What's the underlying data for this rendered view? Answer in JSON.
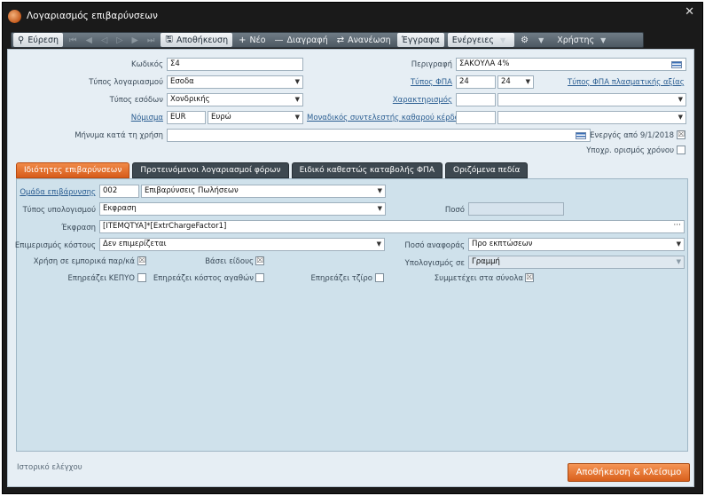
{
  "window": {
    "title": "Λογαριασμός επιβαρύνσεων"
  },
  "toolbar": {
    "search": "Εύρεση",
    "save": "Αποθήκευση",
    "new": "Νέο",
    "delete": "Διαγραφή",
    "refresh": "Ανανέωση",
    "form": "Έγγραφα",
    "actions": "Ενέργειες",
    "user": "Χρήστης"
  },
  "form": {
    "code_label": "Κωδικός",
    "code_value": "Σ4",
    "description_label": "Περιγραφή",
    "description_value": "ΣΑΚΟΥΛΑ 4%",
    "account_type_label": "Τύπος λογαριασμού",
    "account_type_value": "Εσοδα",
    "vat_type_label": "Τύπος ΦΠΑ",
    "vat_type_value1": "24",
    "vat_type_value2": "24",
    "vat_type_link": "Τύπος ΦΠΑ πλασματικής αξίας",
    "revenue_type_label": "Τύπος εσόδων",
    "revenue_type_value": "Χονδρικής",
    "characterization_label": "Χαρακτηρισμός",
    "currency_label": "Νόμισμα",
    "currency_code": "EUR",
    "currency_name": "Ευρώ",
    "net_profit_label": "Μοναδικός συντελεστής καθαρού κέρδους",
    "message_label": "Μήνυμα κατά τη χρήση",
    "active_from_label": "Ενεργός από 9/1/2018",
    "active_check": "☒",
    "time_def_label": "Υποχρ. ορισμός χρόνου"
  },
  "tabs": [
    "Ιδιότητες επιβαρύνσεων",
    "Προτεινόμενοι λογαριασμοί φόρων",
    "Ειδικό καθεστώς καταβολής ΦΠΑ",
    "Οριζόμενα πεδία"
  ],
  "panel": {
    "group_label": "Ομάδα επιβάρυνσης",
    "group_code": "002",
    "group_name": "Επιβαρύνσεις Πωλήσεων",
    "calc_type_label": "Τύπος υπολογισμού",
    "calc_type_value": "Εκφραση",
    "amount_label": "Ποσό",
    "expression_label": "Έκφραση",
    "expression_value": "[ITEMQTYA]*[ExtrChargeFactor1]",
    "cost_split_label": "Επιμερισμός κόστους",
    "cost_split_value": "Δεν επιμερίζεται",
    "ref_amount_label": "Ποσό αναφοράς",
    "ref_amount_value": "Προ εκπτώσεων",
    "commercial_label": "Χρήση σε εμπορικά παρ/κά",
    "commercial_check": "☒",
    "by_item_label": "Βάσει είδους",
    "by_item_check": "☒",
    "calc_in_label": "Υπολογισμός σε",
    "calc_in_value": "Γραμμή",
    "kepyo_label": "Επηρεάζει ΚΕΠΥΟ",
    "goods_cost_label": "Επηρεάζει κόστος αγαθών",
    "turnover_label": "Επηρεάζει τζίρο",
    "totals_label": "Συμμετέχει στα σύνολα",
    "totals_check": "☒"
  },
  "footer": {
    "audit_link": "Ιστορικό ελέγχου",
    "save_close": "Αποθήκευση & Κλείσιμο"
  },
  "colors": {
    "accent": "#e06a26",
    "panel": "#cfe1eb",
    "content": "#e6eef4"
  }
}
